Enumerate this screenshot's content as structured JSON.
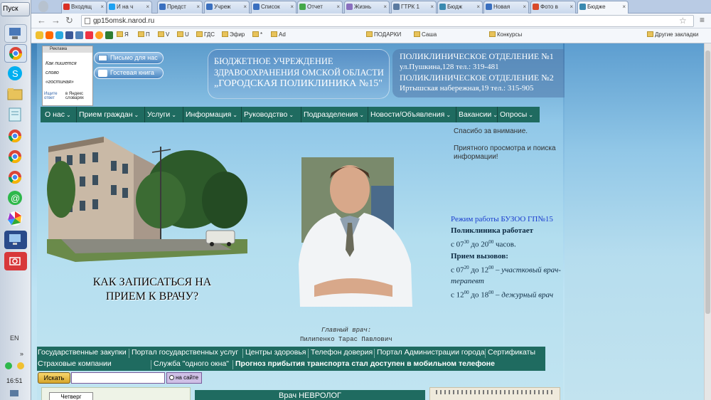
{
  "taskbar": {
    "start_label": "Пуск",
    "lang": "EN",
    "time": "16:51"
  },
  "tabs": [
    {
      "label": "Входящ",
      "color": "#d93025"
    },
    {
      "label": "И на ч",
      "color": "#1da1f2"
    },
    {
      "label": "Предст",
      "color": "#3a6fbf"
    },
    {
      "label": "Учреж",
      "color": "#3a6fbf"
    },
    {
      "label": "Список",
      "color": "#3a6fbf"
    },
    {
      "label": "Отчет",
      "color": "#45a84a"
    },
    {
      "label": "Жизнь",
      "color": "#8a6fbf"
    },
    {
      "label": "ГТРК 1",
      "color": "#5a7aa0"
    },
    {
      "label": "Бюдж",
      "color": "#3a8ab0"
    },
    {
      "label": "Новая",
      "color": "#3a6fbf"
    },
    {
      "label": "Фото в",
      "color": "#d94a2a"
    },
    {
      "label": "Бюдже",
      "color": "#3a8ab0"
    }
  ],
  "address": {
    "url": "gp15omsk.narod.ru"
  },
  "bookmarks": [
    {
      "label": "Я"
    },
    {
      "label": "П"
    },
    {
      "label": "V"
    },
    {
      "label": "U"
    },
    {
      "label": "ГДС"
    },
    {
      "label": "Эфир"
    },
    {
      "label": "*"
    },
    {
      "label": "Ad"
    },
    {
      "label": "ПОДАРКИ"
    },
    {
      "label": "Саша"
    },
    {
      "label": "Конкурсы"
    },
    {
      "label": "Другие закладки"
    }
  ],
  "ad": {
    "header": "Реклама",
    "line1": "Как пишется",
    "line2": "слово",
    "line3": "«гостиная»",
    "find": "Ищите ответ",
    "yandex": "в Яндекс словарях"
  },
  "site": {
    "letter_btn": "Письмо для нас",
    "guest_btn": "Гостевая книга",
    "org_line1": "БЮДЖЕТНОЕ УЧРЕЖДЕНИЕ",
    "org_line2": "ЗДРАВООХРАНЕНИЯ ОМСКОЙ ОБЛАСТИ",
    "org_line3": "„ГОРОДСКАЯ ПОЛИКЛИНИКА №15\"",
    "dept1": "ПОЛИКЛИНИЧЕСКОЕ ОТДЕЛЕНИЕ №1",
    "dept1_addr": "ул.Пушкина,128  тел.: 319-481",
    "dept2": "ПОЛИКЛИНИЧЕСКОЕ ОТДЕЛЕНИЕ №2",
    "dept2_addr": "Иртышская набережная,19 тел.: 315-905"
  },
  "nav": [
    "О нас",
    "Прием граждан",
    "Услуги",
    "Информация",
    "Руководство",
    "Подразделения",
    "Новости/Объявления",
    "Вакансии",
    "Опросы"
  ],
  "main": {
    "cta": "КАК ЗАПИСАТЬСЯ НА ПРИЕМ К ВРАЧУ?",
    "chief_title": "Главный врач:",
    "chief_name": "Пилипенко Тарас Павлович",
    "thanks1": "Спасибо за внимание.",
    "thanks2": "Приятного просмотра и поиска",
    "thanks3": "информации!",
    "hours_title": "Режим работы БУЗОО ГП№15",
    "works": "Поликлиника работает",
    "works_time_from": "с 07",
    "works_sup1": "30",
    "works_time_to": " до 20",
    "works_sup2": "00",
    "works_suffix": " часов.",
    "calls": "Прием вызовов:",
    "calls1_a": "с 07",
    "calls1_sup1": "20",
    "calls1_b": " до 12",
    "calls1_sup2": "00",
    "calls1_role": " – участковый врач-терапевт",
    "calls2_a": "с 12",
    "calls2_sup1": "00",
    "calls2_b": " до 18",
    "calls2_sup2": "00",
    "calls2_role": " – дежурный врач"
  },
  "links_row1": [
    "Государственные закупки",
    "Портал государственных услуг",
    "Центры здоровья",
    "Телефон доверия",
    "Портал Администрации города",
    "Сертификаты"
  ],
  "links_row2": [
    "Страховые компании",
    "Служба \"одного окна\"",
    "Прогноз прибытия транспорта стал доступен в мобильном телефоне"
  ],
  "search": {
    "button": "Искать",
    "on_site": "на сайте"
  },
  "bottom": {
    "thursday": "Четверг",
    "neurologist": "Врач НЕВРОЛОГ"
  }
}
